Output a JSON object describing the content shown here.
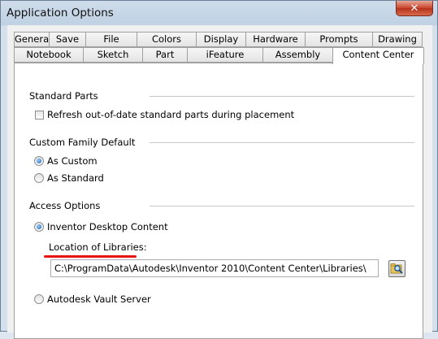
{
  "window": {
    "title": "Application Options",
    "close_glyph": "✕"
  },
  "tabs_row1": [
    "General",
    "Save",
    "File",
    "Colors",
    "Display",
    "Hardware",
    "Prompts",
    "Drawing"
  ],
  "tabs_row2": [
    "Notebook",
    "Sketch",
    "Part",
    "iFeature",
    "Assembly",
    "Content Center"
  ],
  "active_tab": "Content Center",
  "standard_parts": {
    "heading": "Standard Parts",
    "refresh_label": "Refresh out-of-date standard parts during placement",
    "refresh_checked": false
  },
  "custom_family": {
    "heading": "Custom Family Default",
    "as_custom_label": "As Custom",
    "as_standard_label": "As Standard",
    "selected": "As Custom"
  },
  "access_options": {
    "heading": "Access Options",
    "desktop_label": "Inventor Desktop Content",
    "location_label": "Location of Libraries:",
    "location_value": "C:\\ProgramData\\Autodesk\\Inventor 2010\\Content Center\\Libraries\\",
    "vault_label": "Autodesk Vault Server",
    "selected": "Inventor Desktop Content"
  },
  "colors": {
    "annotation_underline": "#e8130f",
    "radio_fill": "#1a5fb4"
  },
  "icons": {
    "browse": "folder-search-icon",
    "close": "close-icon"
  }
}
